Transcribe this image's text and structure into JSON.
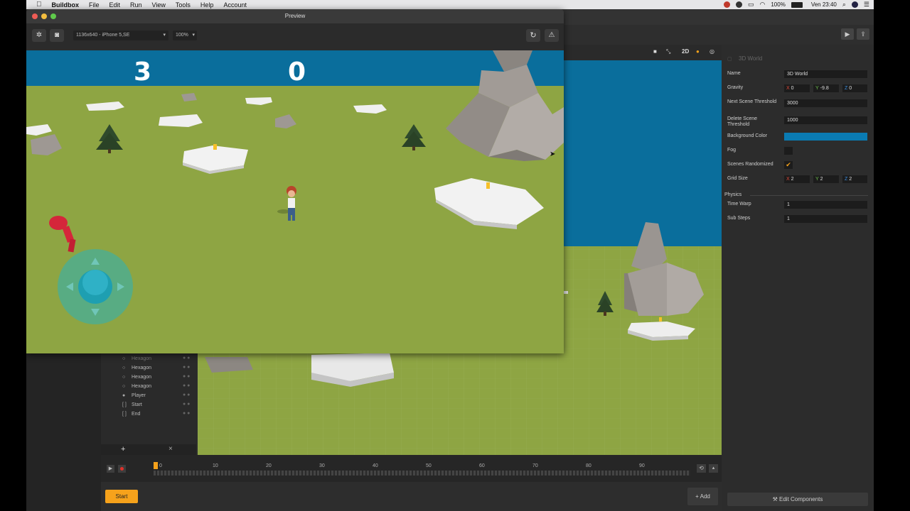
{
  "menubar": {
    "app_name": "Buildbox",
    "items": [
      "File",
      "Edit",
      "Run",
      "View",
      "Tools",
      "Help",
      "Account"
    ],
    "battery": "100%",
    "clock": "Ven 23:40"
  },
  "preview": {
    "title": "Preview",
    "device": "1136x640 - iPhone 5,SE",
    "zoom": "100%",
    "score_left": "3",
    "score_right": "0"
  },
  "viewport": {
    "mode_2d": "2D"
  },
  "tree": {
    "items": [
      {
        "icon": "hexagon-icon",
        "label": "Hexagon"
      },
      {
        "icon": "hexagon-icon",
        "label": "Hexagon"
      },
      {
        "icon": "hexagon-icon",
        "label": "Hexagon"
      },
      {
        "icon": "hexagon-icon",
        "label": "Hexagon"
      },
      {
        "icon": "player-icon",
        "label": "Player"
      },
      {
        "icon": "bracket-icon",
        "label": "Start"
      },
      {
        "icon": "bracket-icon",
        "label": "End"
      }
    ],
    "add_symbol": "+",
    "remove_symbol": "×"
  },
  "timeline": {
    "ticks": [
      "0",
      "10",
      "20",
      "30",
      "40",
      "50",
      "60",
      "70",
      "80",
      "90"
    ]
  },
  "bottom": {
    "start_label": "Start",
    "add_label": "Add"
  },
  "inspector": {
    "title": "3D World",
    "name_label": "Name",
    "name_value": "3D World",
    "gravity_label": "Gravity",
    "gravity": {
      "x": "0",
      "y": "-9.8",
      "z": "0"
    },
    "next_scene_label": "Next Scene Threshold",
    "next_scene_value": "3000",
    "delete_scene_label": "Delete Scene Threshold",
    "delete_scene_value": "1000",
    "bg_color_label": "Background Color",
    "bg_color": "#0a7bb3",
    "fog_label": "Fog",
    "fog_checked": false,
    "scenes_randomized_label": "Scenes Randomized",
    "scenes_randomized_checked": true,
    "grid_size_label": "Grid Size",
    "grid_size": {
      "x": "2",
      "y": "2",
      "z": "2"
    },
    "physics_label": "Physics",
    "time_warp_label": "Time Warp",
    "time_warp_value": "1",
    "sub_steps_label": "Sub Steps",
    "sub_steps_value": "1",
    "edit_components_label": "Edit Components"
  },
  "colors": {
    "sky": "#0a6e9c",
    "grass": "#8ea543",
    "accent": "#f6a21b",
    "joystick": "#2bb3b8"
  }
}
